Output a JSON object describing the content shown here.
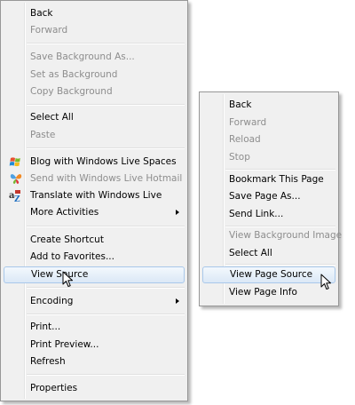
{
  "ie_menu": {
    "back": "Back",
    "forward": "Forward",
    "save_background_as": "Save Background As...",
    "set_as_background": "Set as Background",
    "copy_background": "Copy Background",
    "select_all": "Select All",
    "paste": "Paste",
    "blog_with_spaces": "Blog with Windows Live Spaces",
    "send_with_hotmail": "Send with Windows Live Hotmail",
    "translate": "Translate with Windows Live",
    "more_activities": "More Activities",
    "create_shortcut": "Create Shortcut",
    "add_to_favorites": "Add to Favorites...",
    "view_source": "View Source",
    "encoding": "Encoding",
    "print": "Print...",
    "print_preview": "Print Preview...",
    "refresh": "Refresh",
    "properties": "Properties"
  },
  "ff_menu": {
    "back": "Back",
    "forward": "Forward",
    "reload": "Reload",
    "stop": "Stop",
    "bookmark": "Bookmark This Page",
    "save_page_as": "Save Page As...",
    "send_link": "Send Link...",
    "view_background_image": "View Background Image",
    "select_all": "Select All",
    "view_page_source": "View Page Source",
    "view_page_info": "View Page Info"
  },
  "icons": {
    "blog": "windows-flag-icon",
    "hotmail": "butterfly-icon",
    "translate": "translate-icon",
    "cursor": "mouse-pointer-icon"
  }
}
